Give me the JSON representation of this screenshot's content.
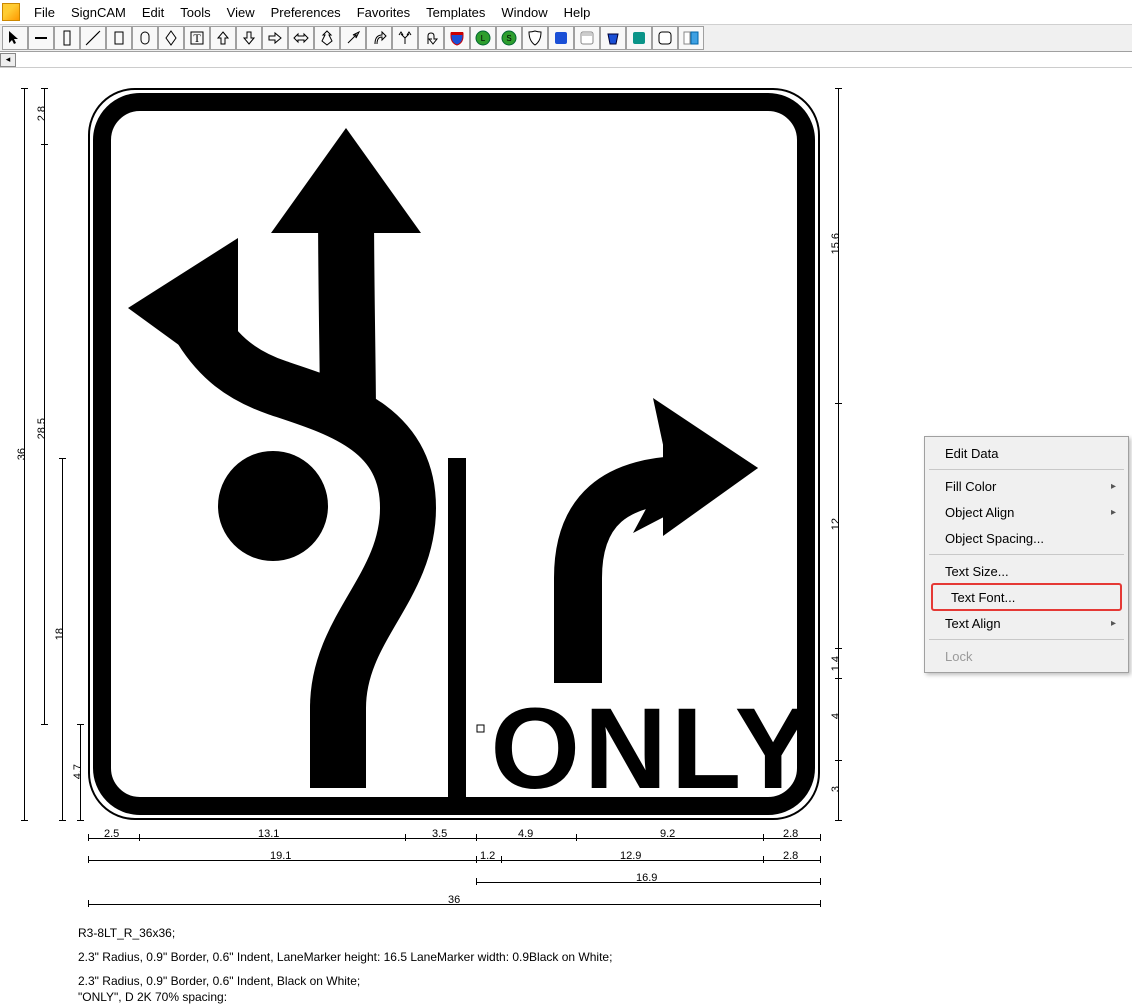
{
  "menu": {
    "items": [
      "File",
      "SignCAM",
      "Edit",
      "Tools",
      "View",
      "Preferences",
      "Favorites",
      "Templates",
      "Window",
      "Help"
    ]
  },
  "toolbar": {
    "icons": [
      "pointer",
      "minus",
      "vertical-bar",
      "diagonal",
      "rect-outline",
      "rounded-rect",
      "diamond",
      "text-tool",
      "arrow-up",
      "arrow-down",
      "arrow-right",
      "arrow-lr",
      "arrow-updown",
      "arrow-ne",
      "arrow-curve-right",
      "arrow-branch",
      "arrow-uturn",
      "shield-blue",
      "shield-green-l",
      "shield-green-s",
      "badge",
      "square-blue",
      "square-white",
      "bucket-blue",
      "square-teal",
      "square-rounded",
      "align"
    ]
  },
  "context_menu": {
    "items": [
      {
        "label": "Edit Data",
        "arrow": false
      },
      {
        "sep": true
      },
      {
        "label": "Fill Color",
        "arrow": true
      },
      {
        "label": "Object Align",
        "arrow": true
      },
      {
        "label": "Object Spacing...",
        "arrow": false
      },
      {
        "sep": true
      },
      {
        "label": "Text Size...",
        "arrow": false
      },
      {
        "label": "Text Font...",
        "arrow": false,
        "highlighted": true
      },
      {
        "label": "Text Align",
        "arrow": true
      },
      {
        "sep": true
      },
      {
        "label": "Lock",
        "arrow": false,
        "disabled": true
      }
    ]
  },
  "sign": {
    "only_label": "ONLY"
  },
  "dimensions": {
    "left_outer": "36",
    "left_upper": "28.5",
    "left_lower": "18",
    "left_top_margin": "2.8",
    "left_bottom_margin": "4.7",
    "right_upper": "15.6",
    "right_mid": "12",
    "right_small1": "1.4",
    "right_small2": "4",
    "right_bottom": "3",
    "bottom_row1": [
      "2.5",
      "13.1",
      "3.5",
      "4.9",
      "9.2",
      "2.8"
    ],
    "bottom_row2": [
      "19.1",
      "1.2",
      "12.9",
      "2.8"
    ],
    "bottom_row3": "16.9",
    "bottom_total": "36"
  },
  "description": {
    "line1": "R3-8LT_R_36x36;",
    "line2": "2.3\" Radius, 0.9\" Border, 0.6\" Indent,  LaneMarker height: 16.5 LaneMarker width: 0.9Black on White;",
    "line3": "2.3\" Radius, 0.9\" Border, 0.6\" Indent, Black on White;",
    "line4": "\"ONLY\",  D 2K 70% spacing:"
  }
}
